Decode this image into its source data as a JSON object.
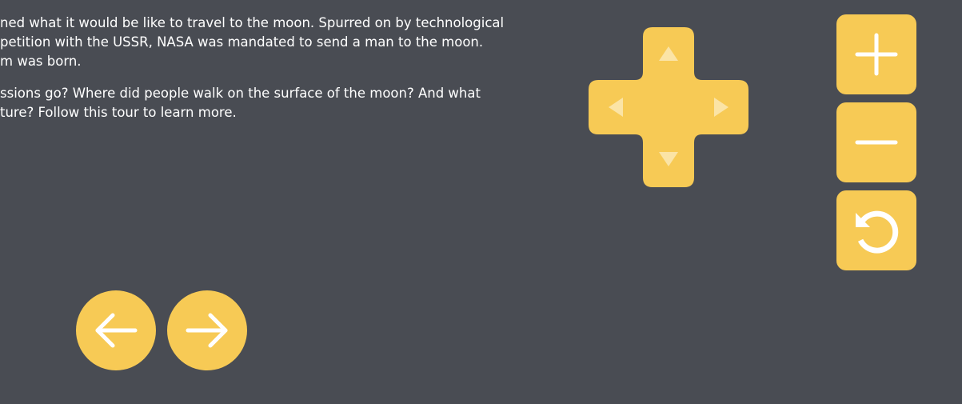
{
  "intro": {
    "paragraph1_lines": [
      "ned what it would be like to travel to the moon. Spurred on by technological",
      "petition with the USSR, NASA was mandated to send a man to the moon.",
      "m was born."
    ],
    "paragraph2_lines": [
      "ssions go? Where did people walk on the surface of the moon? And what",
      "ture? Follow this tour to learn more."
    ]
  },
  "controls": {
    "accent_color": "#f7ca55",
    "arrow_color": "#fbe4a6",
    "icon_color": "#ffffff",
    "background_color": "#494c53",
    "dpad_icons": [
      "arrow-up-icon",
      "arrow-down-icon",
      "arrow-left-icon",
      "arrow-right-icon"
    ],
    "zoom_icons": [
      "plus-icon",
      "minus-icon",
      "reset-icon"
    ],
    "nav_icons": [
      "arrow-left-icon",
      "arrow-right-icon"
    ]
  }
}
